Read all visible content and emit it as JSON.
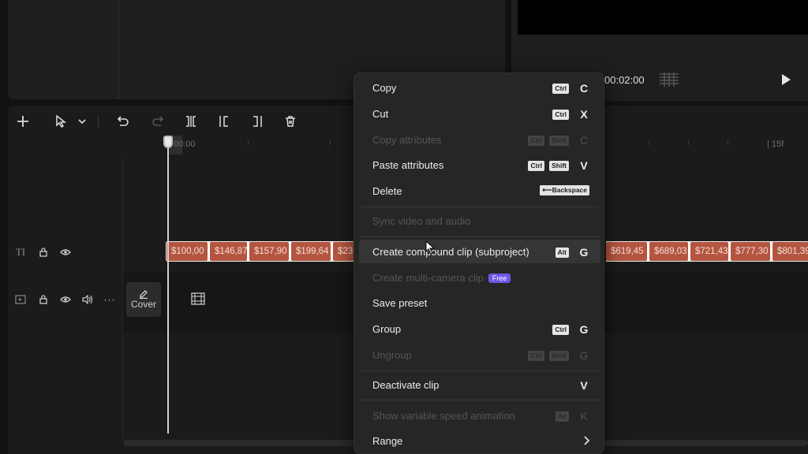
{
  "preview": {
    "timecode": "00:02:00"
  },
  "toolbar": {
    "items": [
      "add",
      "select",
      "select-dropdown",
      "undo",
      "redo",
      "split",
      "split-left",
      "split-right",
      "delete"
    ]
  },
  "timeline": {
    "ruler_start": "00:00",
    "ruler_end": "15f",
    "clips_left": [
      "$100,00",
      "$146,87",
      "$157,90",
      "$199,64",
      "$23"
    ],
    "clips_right": [
      "$619,45",
      "$689,03",
      "$721,43",
      "$777,30",
      "$801,39"
    ],
    "cover_label": "Cover"
  },
  "context_menu": {
    "items": [
      {
        "label": "Copy",
        "keys": [
          "Ctrl"
        ],
        "letter": "C",
        "enabled": true
      },
      {
        "label": "Cut",
        "keys": [
          "Ctrl"
        ],
        "letter": "X",
        "enabled": true
      },
      {
        "label": "Copy attributes",
        "keys": [
          "Ctrl",
          "Shift"
        ],
        "letter": "C",
        "enabled": false
      },
      {
        "label": "Paste attributes",
        "keys": [
          "Ctrl",
          "Shift"
        ],
        "letter": "V",
        "enabled": true
      },
      {
        "label": "Delete",
        "keys": [
          "⟵Backspace"
        ],
        "letter": "",
        "enabled": true
      },
      {
        "label": "Sync video and audio",
        "keys": [],
        "letter": "",
        "enabled": false
      },
      {
        "label": "Create compound clip (subproject)",
        "keys": [
          "Alt"
        ],
        "letter": "G",
        "enabled": true
      },
      {
        "label": "Create multi-camera clip",
        "badge": "Free",
        "keys": [],
        "letter": "",
        "enabled": false
      },
      {
        "label": "Save preset",
        "keys": [],
        "letter": "",
        "enabled": true
      },
      {
        "label": "Group",
        "keys": [
          "Ctrl"
        ],
        "letter": "G",
        "enabled": true
      },
      {
        "label": "Ungroup",
        "keys": [
          "Ctrl",
          "Shift"
        ],
        "letter": "G",
        "enabled": false
      },
      {
        "label": "Deactivate clip",
        "keys": [],
        "letter": "V",
        "enabled": true
      },
      {
        "label": "Show variable speed animation",
        "keys": [
          "Alt"
        ],
        "letter": "K",
        "enabled": false
      },
      {
        "label": "Range",
        "keys": [],
        "letter": "",
        "enabled": true
      }
    ]
  },
  "colors": {
    "clip": "#b4553f",
    "badge": "#6f56e6",
    "menu_bg": "#262626"
  }
}
